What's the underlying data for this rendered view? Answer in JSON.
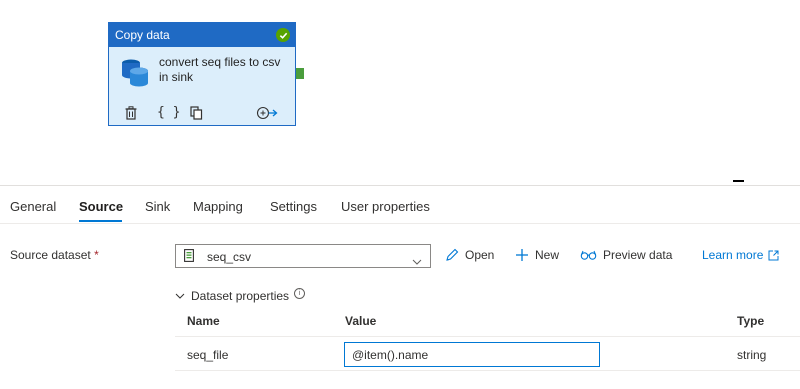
{
  "activity": {
    "type_label": "Copy data",
    "name_line1": "convert seq files to csv",
    "name_line2": "in sink",
    "status": "succeeded",
    "icons": [
      "check-icon",
      "database-icon",
      "delete-icon",
      "code-icon",
      "copy-icon",
      "add-output-icon"
    ]
  },
  "tabs": [
    {
      "label": "General"
    },
    {
      "label": "Source"
    },
    {
      "label": "Sink"
    },
    {
      "label": "Mapping"
    },
    {
      "label": "Settings"
    },
    {
      "label": "User properties"
    }
  ],
  "active_tab": "Source",
  "source": {
    "dataset_label": "Source dataset",
    "required_mark": "*",
    "dataset_value": "seq_csv",
    "actions": {
      "open": "Open",
      "new": "New",
      "preview": "Preview data",
      "learn_more": "Learn more"
    }
  },
  "dataset_properties": {
    "toggle_label": "Dataset properties",
    "columns": [
      "Name",
      "Value",
      "Type"
    ],
    "rows": [
      {
        "name": "seq_file",
        "value": "@item().name",
        "type": "string"
      }
    ]
  },
  "colors": {
    "accent": "#0078d4",
    "header": "#1f6ac4",
    "card_bg": "#dceefb",
    "success": "#57a300"
  }
}
